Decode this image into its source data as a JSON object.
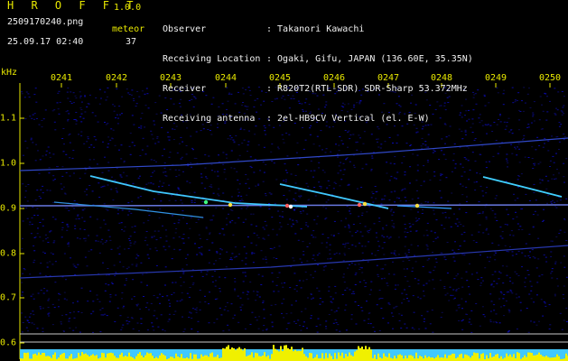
{
  "header": {
    "app_name": "H R O F F T",
    "app_version": "1.0.0",
    "filename": "2509170240.png",
    "meteor_label": "meteor",
    "datetime": "25.09.17 02:40",
    "meteor_count": "37"
  },
  "station_info": [
    {
      "key": "Observer",
      "value": ": Takanori Kawachi"
    },
    {
      "key": "Receiving Location",
      "value": ": Ogaki, Gifu, JAPAN (136.60E, 35.35N)"
    },
    {
      "key": "Receiver",
      "value": ": R820T2(RTL-SDR) SDR-Sharp 53.372MHz"
    },
    {
      "key": "Receiving antenna",
      "value": ": 2el-HB9CV Vertical (el. E-W)"
    }
  ],
  "axes": {
    "freq_unit": "kHz",
    "time_ticks": [
      "0241",
      "0242",
      "0243",
      "0244",
      "0245",
      "0246",
      "0247",
      "0248",
      "0249",
      "0250"
    ],
    "freq_ticks": [
      "1.1",
      "1.0",
      "0.9",
      "0.8",
      "0.7",
      "0.6"
    ]
  },
  "colors": {
    "background": "#000000",
    "label_yellow": "#e8e800",
    "text_white": "#f0f0f0",
    "noise_floor": "#0a0a78",
    "signal_cyan": "#40d0ff"
  }
}
